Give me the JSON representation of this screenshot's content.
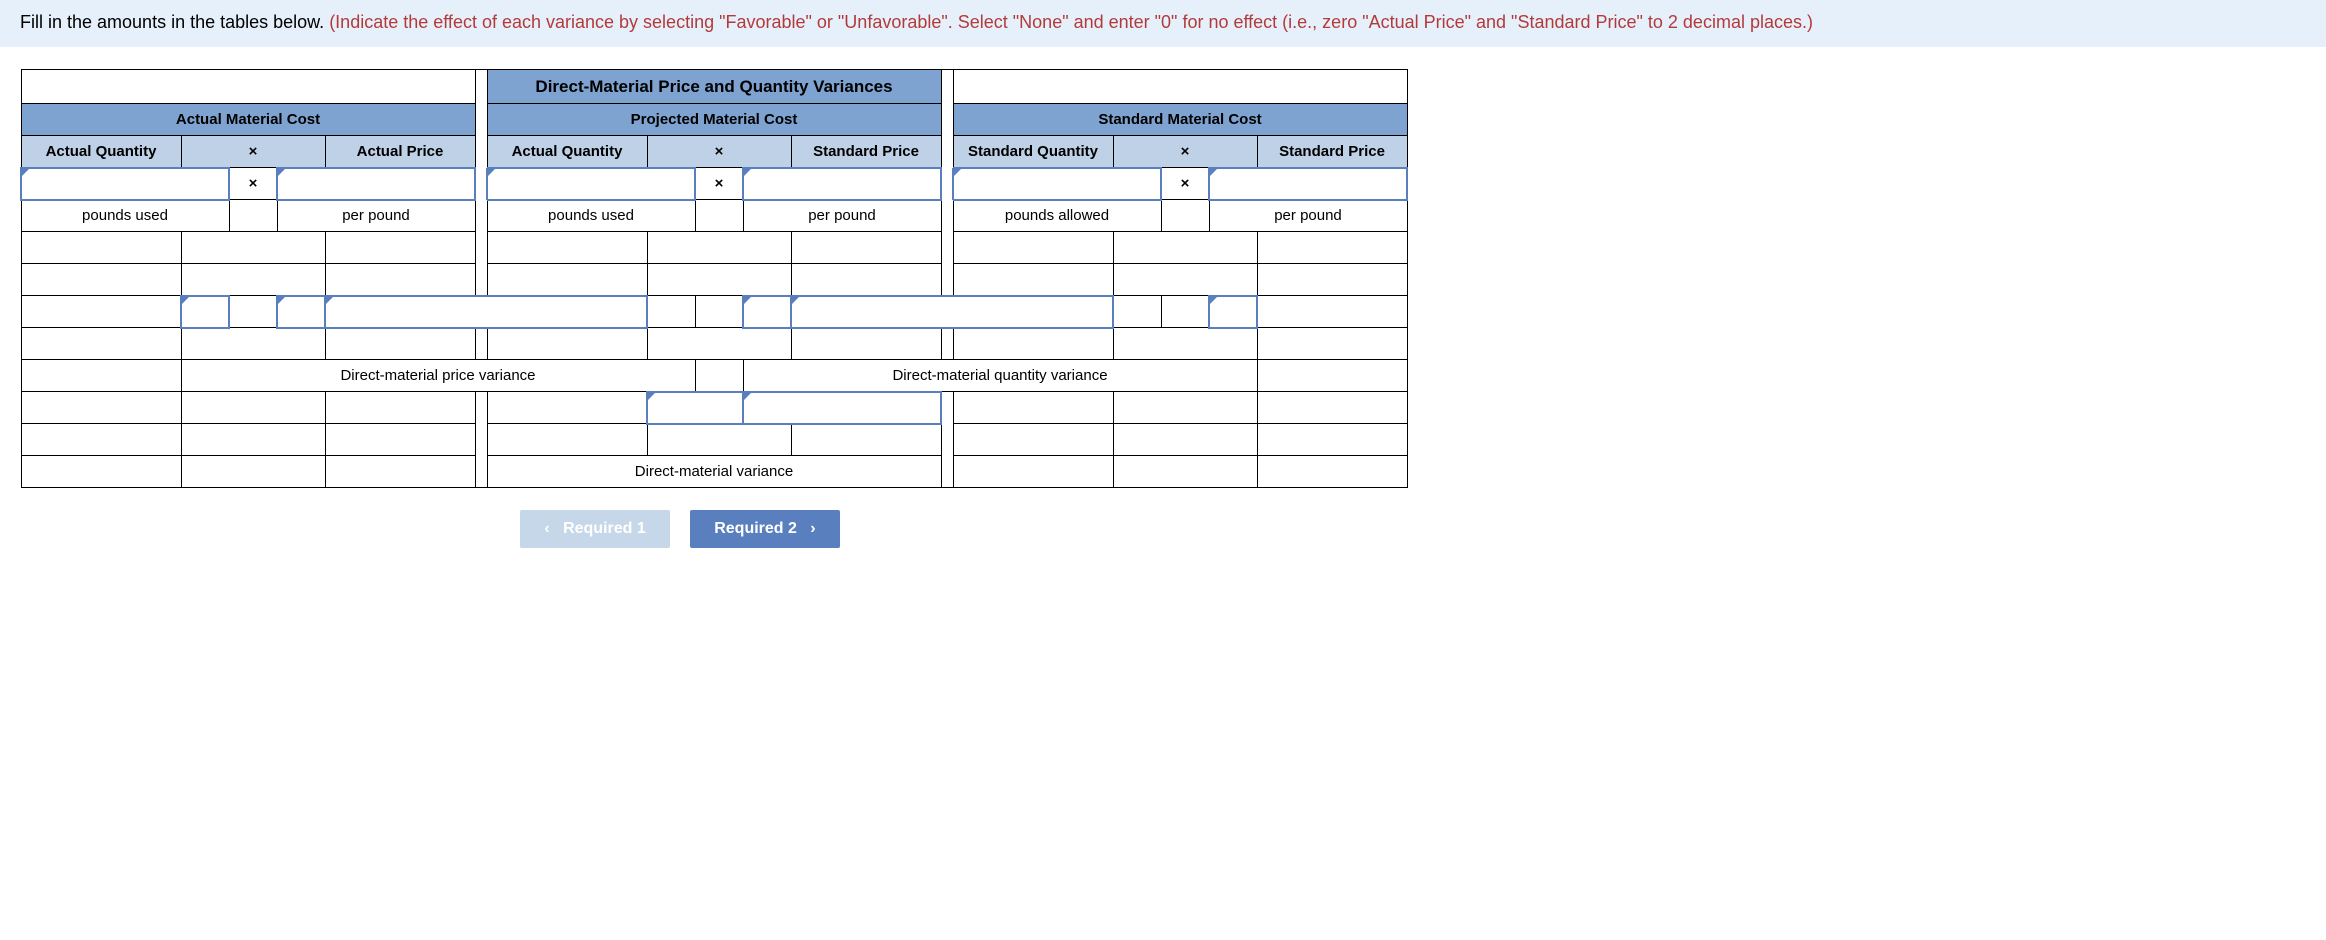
{
  "instructions": {
    "lead": "Fill in the amounts in the tables below. ",
    "red": "(Indicate the effect of each variance by selecting \"Favorable\" or \"Unfavorable\". Select \"None\" and enter \"0\" for no effect (i.e., zero \"Actual Price\" and \"Standard Price\" to 2 decimal places.)"
  },
  "table": {
    "title": "Direct-Material Price and Quantity Variances",
    "sections": {
      "actual": {
        "header": "Actual Material Cost",
        "col1": "Actual Quantity",
        "colx": "×",
        "col2": "Actual Price",
        "unit1": "pounds used",
        "unit2": "per pound"
      },
      "projected": {
        "header": "Projected Material Cost",
        "col1": "Actual Quantity",
        "colx": "×",
        "col2": "Standard Price",
        "unit1": "pounds used",
        "unit2": "per pound"
      },
      "standard": {
        "header": "Standard Material Cost",
        "col1": "Standard Quantity",
        "colx": "×",
        "col2": "Standard Price",
        "unit1": "pounds allowed",
        "unit2": "per pound"
      }
    },
    "variance_labels": {
      "price": "Direct-material price variance",
      "quantity": "Direct-material quantity variance",
      "total": "Direct-material variance"
    },
    "x": "×"
  },
  "nav": {
    "prev": "Required 1",
    "next": "Required 2",
    "chev_left": "‹",
    "chev_right": "›"
  }
}
